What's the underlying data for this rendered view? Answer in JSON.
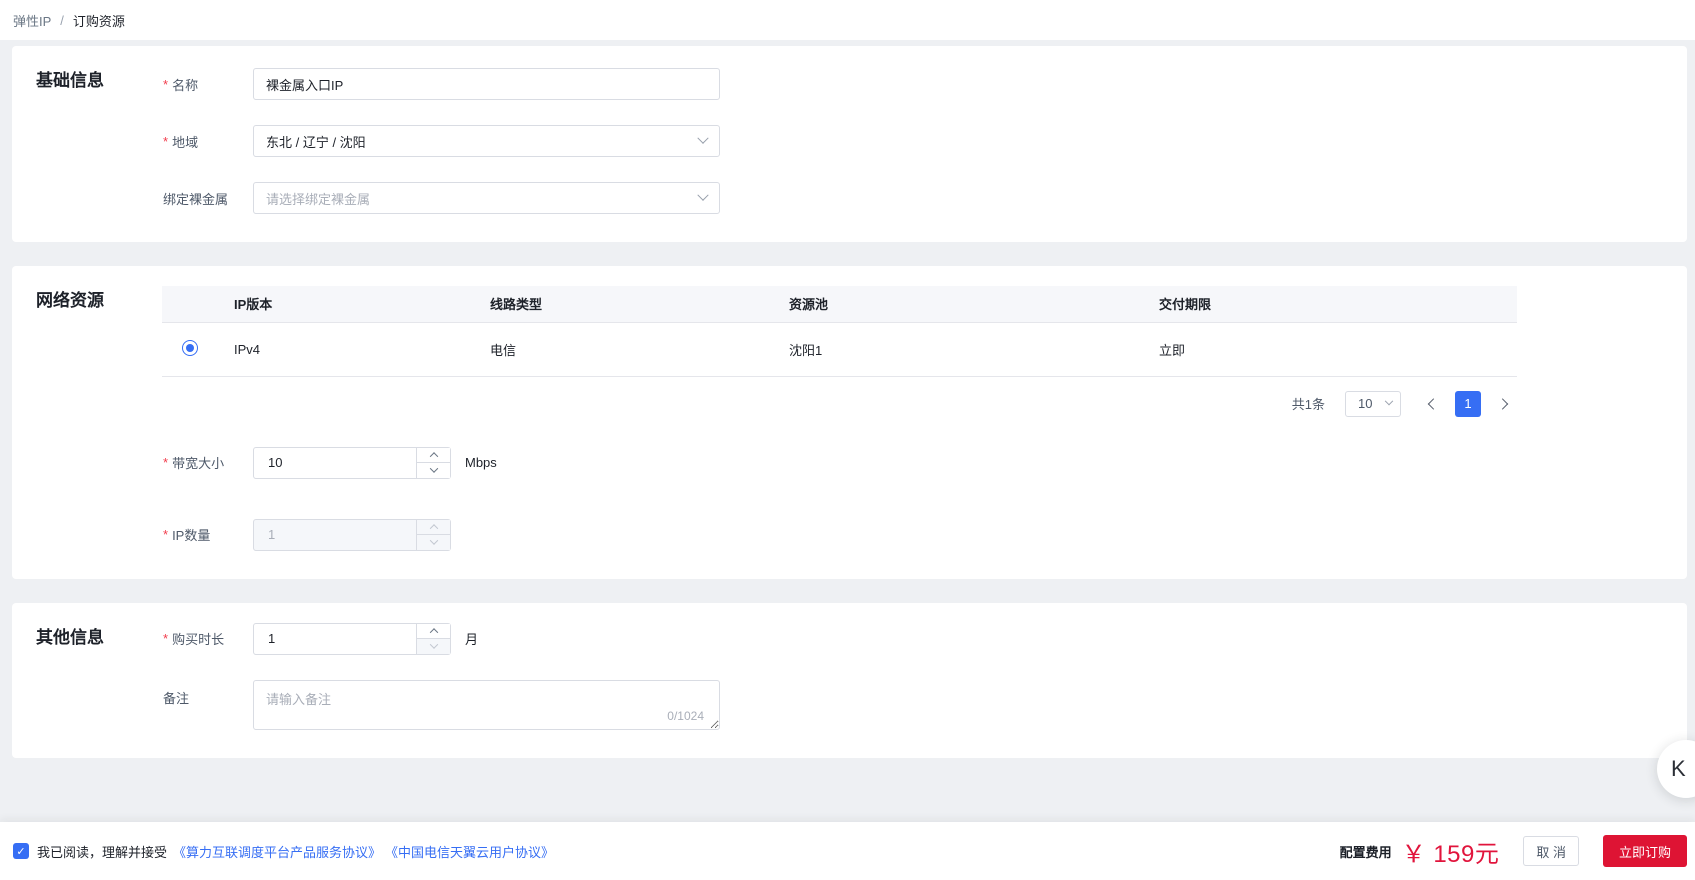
{
  "ui": {
    "required_marker": "*"
  },
  "breadcrumb": {
    "parent": "弹性IP",
    "separator": "/",
    "current": "订购资源"
  },
  "sections": {
    "basic": {
      "title": "基础信息",
      "name_label": "名称",
      "name_value": "裸金属入口IP",
      "region_label": "地域",
      "region_value": "东北 / 辽宁 / 沈阳",
      "bare_metal_label": "绑定裸金属",
      "bare_metal_placeholder": "请选择绑定裸金属"
    },
    "network": {
      "title": "网络资源",
      "table": {
        "headers": [
          "IP版本",
          "线路类型",
          "资源池",
          "交付期限"
        ],
        "row": {
          "ip_version": "IPv4",
          "line_type": "电信",
          "pool": "沈阳1",
          "delivery": "立即"
        }
      },
      "pagination": {
        "total": "共1条",
        "page_size": "10",
        "current_page": "1"
      },
      "bandwidth_label": "带宽大小",
      "bandwidth_value": "10",
      "bandwidth_unit": "Mbps",
      "ip_count_label": "IP数量",
      "ip_count_value": "1"
    },
    "other": {
      "title": "其他信息",
      "duration_label": "购买时长",
      "duration_value": "1",
      "duration_unit": "月",
      "remark_label": "备注",
      "remark_placeholder": "请输入备注",
      "remark_counter": "0/1024"
    }
  },
  "footer": {
    "agreement_prefix": "我已阅读，理解并接受",
    "agreement_links": [
      "《算力互联调度平台产品服务协议》",
      "《中国电信天翼云用户协议》"
    ],
    "fee_label": "配置费用",
    "fee_value": "￥ 159元",
    "cancel_label": "取 消",
    "submit_label": "立即订购"
  },
  "float_button": {
    "label": "K"
  },
  "colors": {
    "accent_blue": "#366ef4",
    "brand_red": "#de1434",
    "price_red": "#e1143c",
    "page_bg": "#eef0f3"
  }
}
